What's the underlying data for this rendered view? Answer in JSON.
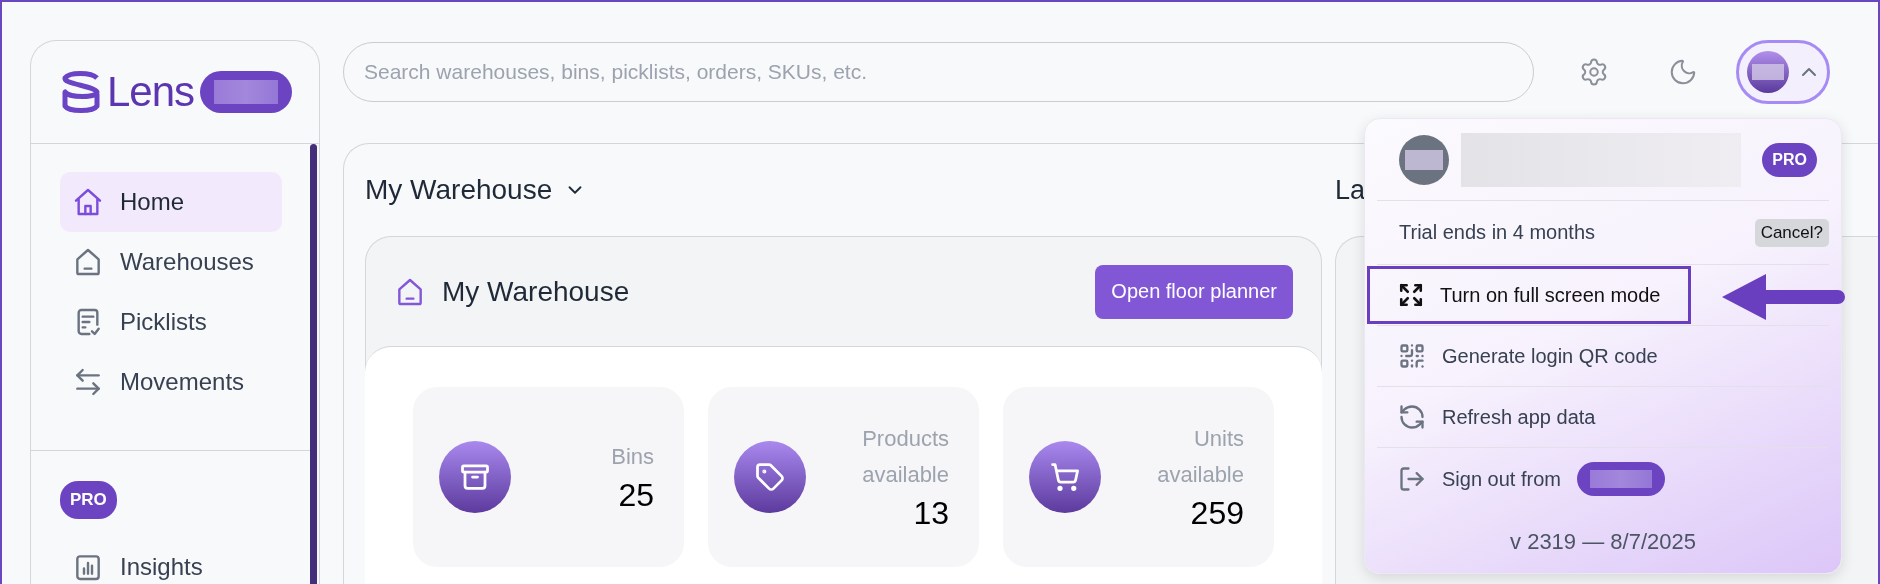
{
  "sidebar": {
    "logo": "Lens",
    "nav": [
      {
        "label": "Home",
        "selected": true
      },
      {
        "label": "Warehouses",
        "selected": false
      },
      {
        "label": "Picklists",
        "selected": false
      },
      {
        "label": "Movements",
        "selected": false
      }
    ],
    "pro_badge": "PRO",
    "pro_nav": [
      {
        "label": "Insights",
        "selected": false
      }
    ]
  },
  "search": {
    "placeholder": "Search warehouses, bins, picklists, orders, SKUs, etc."
  },
  "account_button": {
    "expanded": true
  },
  "main": {
    "warehouse_select": "My Warehouse",
    "card": {
      "title": "My Warehouse",
      "button": "Open floor planner",
      "stats": [
        {
          "label": "Bins",
          "value": "25"
        },
        {
          "label": "Products available",
          "value": "13"
        },
        {
          "label": "Units available",
          "value": "259"
        }
      ]
    },
    "side_panel_title": "La"
  },
  "account_menu": {
    "badge": "PRO",
    "trial": "Trial ends in 4 months",
    "cancel": "Cancel?",
    "items": [
      {
        "label": "Turn on full screen mode",
        "highlighted": true
      },
      {
        "label": "Generate login QR code",
        "highlighted": false
      },
      {
        "label": "Refresh app data",
        "highlighted": false
      },
      {
        "label": "Sign out from",
        "highlighted": false
      }
    ],
    "version": "v 2319 — 8/7/2025"
  }
}
